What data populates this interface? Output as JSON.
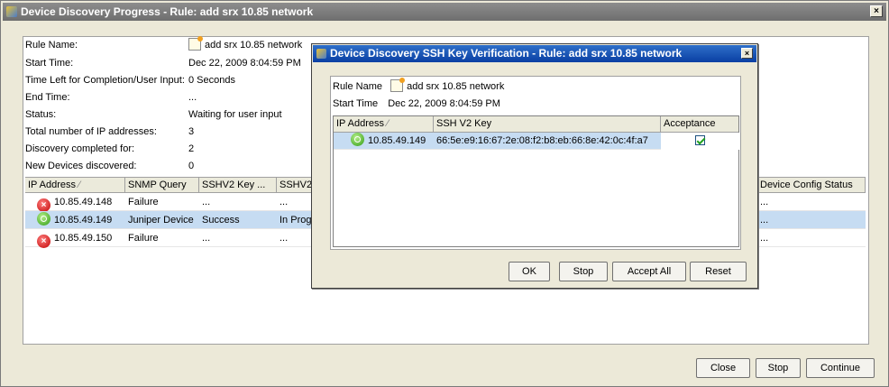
{
  "window": {
    "title": "Device Discovery Progress - Rule: add srx 10.85 network",
    "close_glyph": "×"
  },
  "info": [
    {
      "label": "Rule Name:",
      "value": "add srx 10.85 network"
    },
    {
      "label": "Start Time:",
      "value": "Dec 22, 2009 8:04:59 PM"
    },
    {
      "label": "Time Left for Completion/User Input:",
      "value": "0 Seconds"
    },
    {
      "label": "End Time:",
      "value": "..."
    },
    {
      "label": "Status:",
      "value": "Waiting for user input"
    },
    {
      "label": "Total number of IP addresses:",
      "value": "3"
    },
    {
      "label": "Discovery completed for:",
      "value": "2"
    },
    {
      "label": "New Devices discovered:",
      "value": "0"
    }
  ],
  "table": {
    "headers": [
      "IP Address",
      "SNMP Query",
      "SSHV2 Key ...",
      "SSHV2",
      "Device Config Status"
    ],
    "sort_glyph": "⁄",
    "rows": [
      {
        "status": "error",
        "ip": "10.85.49.148",
        "snmp": "Failure",
        "key": "...",
        "sshv2": "...",
        "config": "..."
      },
      {
        "status": "ok",
        "ip": "10.85.49.149",
        "snmp": "Juniper Device",
        "key": "Success",
        "sshv2": "In Progr",
        "config": "..."
      },
      {
        "status": "error",
        "ip": "10.85.49.150",
        "snmp": "Failure",
        "key": "...",
        "sshv2": "...",
        "config": "..."
      }
    ]
  },
  "buttons": {
    "close": "Close",
    "stop": "Stop",
    "continue": "Continue"
  },
  "dialog": {
    "title": "Device Discovery SSH Key Verification - Rule: add srx 10.85 network",
    "close_glyph": "×",
    "rule_name_label": "Rule Name",
    "rule_name_value": "add srx 10.85 network",
    "start_time_label": "Start Time",
    "start_time_value": "Dec 22, 2009 8:04:59 PM",
    "headers": [
      "IP Address",
      "SSH V2 Key",
      "Acceptance"
    ],
    "rows": [
      {
        "ip": "10.85.49.149",
        "key": "66:5e:e9:16:67:2e:08:f2:b8:eb:66:8e:42:0c:4f:a7",
        "accepted": true
      }
    ],
    "buttons": {
      "ok": "OK",
      "stop": "Stop",
      "accept_all": "Accept All",
      "reset": "Reset"
    }
  }
}
